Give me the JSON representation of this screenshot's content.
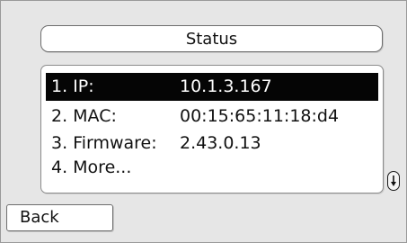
{
  "header": {
    "title": "Status"
  },
  "status_list": {
    "items": [
      {
        "label": "1. IP:",
        "value": "10.1.3.167",
        "selected": true
      },
      {
        "label": "2. MAC:",
        "value": "00:15:65:11:18:d4",
        "selected": false
      },
      {
        "label": "3. Firmware:",
        "value": "2.43.0.13",
        "selected": false
      },
      {
        "label": "4. More...",
        "value": "",
        "selected": false
      }
    ]
  },
  "scroll_indicator": {
    "icon": "arrow-down-icon"
  },
  "softkeys": {
    "back_label": "Back"
  },
  "colors": {
    "background": "#e6e6e6",
    "selection": "#050505",
    "selection_text": "#ffffff",
    "panel": "#ffffff"
  }
}
